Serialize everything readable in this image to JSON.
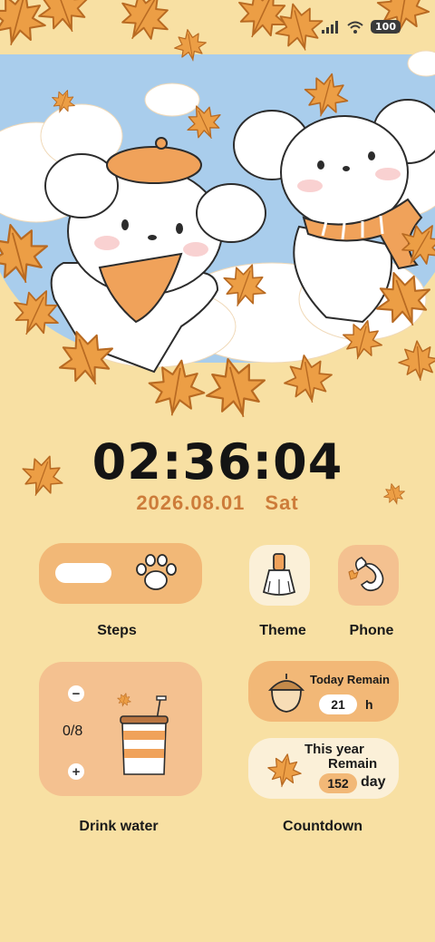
{
  "status_bar": {
    "battery": "100"
  },
  "clock": {
    "time": "02:36:04",
    "date": "2026.08.01",
    "weekday": "Sat"
  },
  "widgets": {
    "steps": {
      "label": "Steps"
    },
    "theme": {
      "label": "Theme"
    },
    "phone": {
      "label": "Phone"
    },
    "drink_water": {
      "label": "Drink water",
      "count": "0/8",
      "minus": "−",
      "plus": "+"
    },
    "today_remain": {
      "title": "Today Remain",
      "value": "21",
      "unit": "h"
    },
    "year_remain": {
      "title_line1": "This year",
      "title_line2": "Remain",
      "value": "152",
      "unit": "day"
    },
    "countdown": {
      "label": "Countdown"
    }
  },
  "colors": {
    "background": "#f8e0a3",
    "card_orange": "#f2b877",
    "card_peach": "#f4c190",
    "accent": "#cd7c3a",
    "leaf": "#ec9e45"
  },
  "icons": [
    "paw-icon",
    "brush-icon",
    "phone-icon",
    "acorn-icon",
    "maple-leaf-icon",
    "cup-icon",
    "wifi-icon",
    "signal-icon"
  ]
}
